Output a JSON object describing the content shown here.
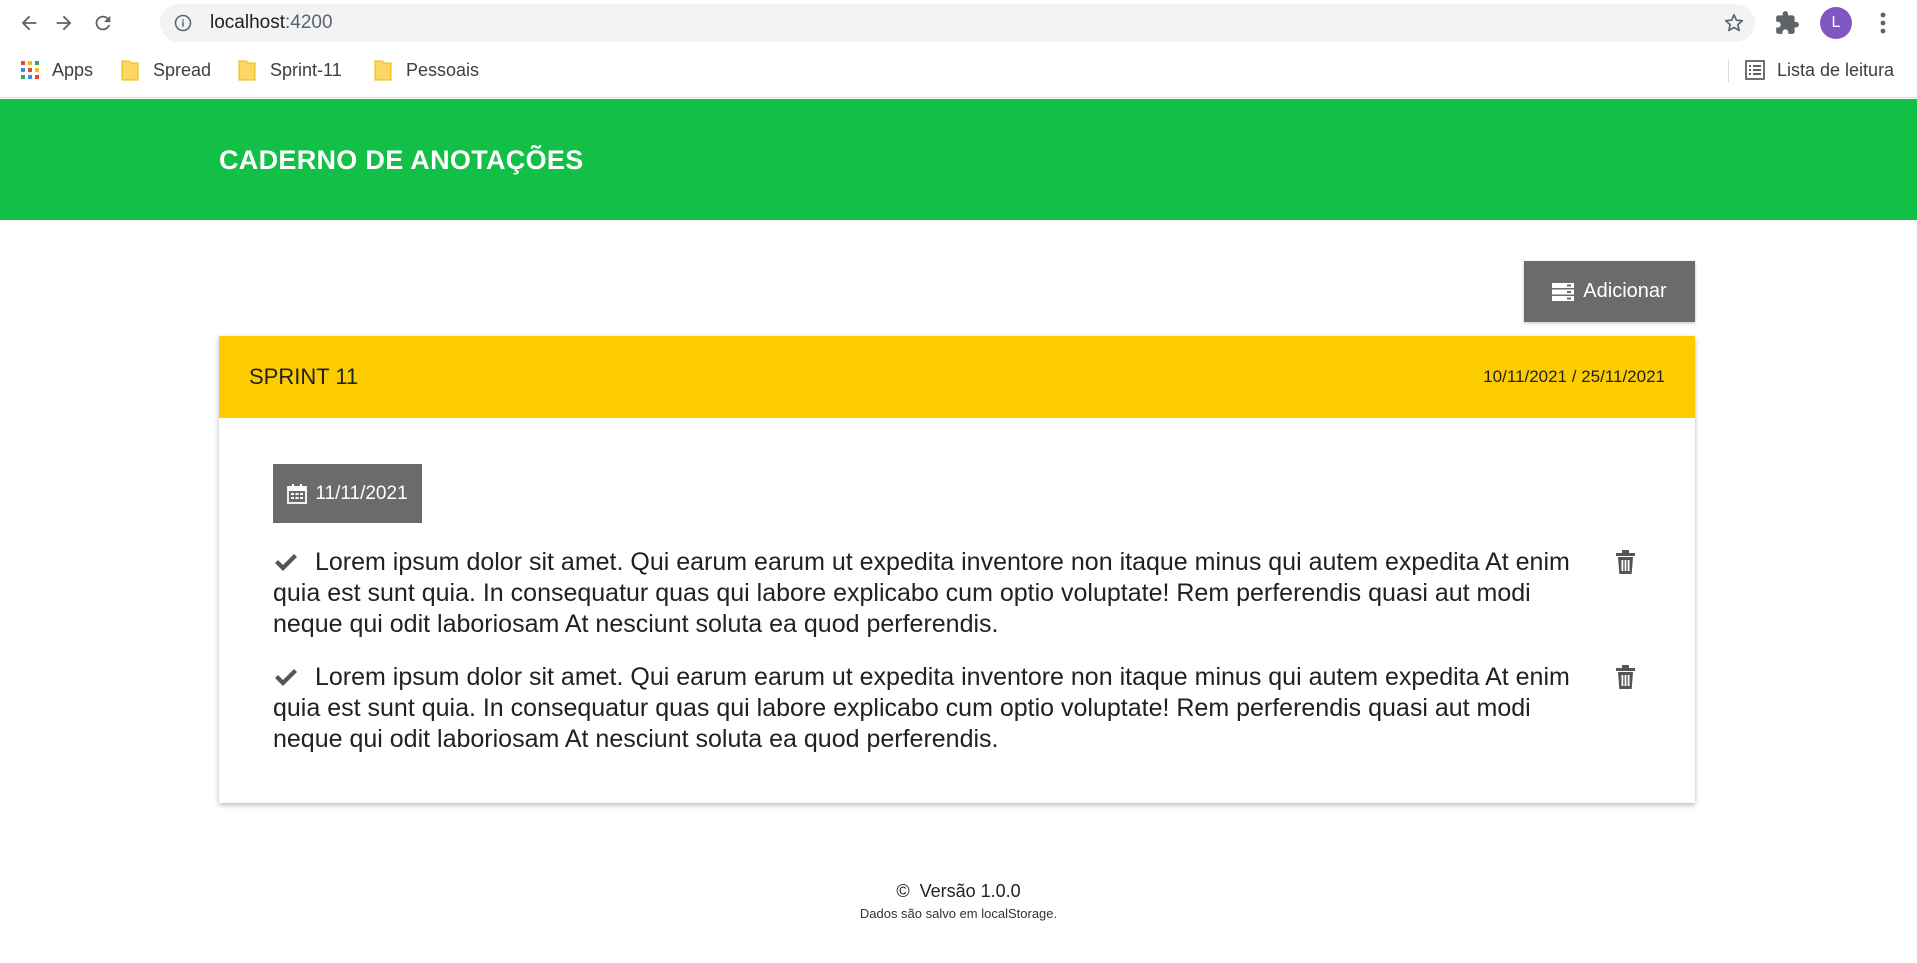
{
  "browser": {
    "url_host": "localhost",
    "url_port": ":4200",
    "profile_initial": "L",
    "bookmarks": [
      {
        "label": "Apps",
        "icon": "apps-grid-icon"
      },
      {
        "label": "Spread",
        "icon": "folder-icon"
      },
      {
        "label": "Sprint-11",
        "icon": "folder-icon"
      },
      {
        "label": "Pessoais",
        "icon": "folder-icon"
      }
    ],
    "reading_list_label": "Lista de leitura"
  },
  "app": {
    "title": "CADERNO DE ANOTAÇÕES",
    "add_button_label": "Adicionar",
    "card": {
      "title": "SPRINT 11",
      "dates": "10/11/2021 / 25/11/2021",
      "day": "11/11/2021",
      "notes": [
        {
          "text": "Lorem ipsum dolor sit amet. Qui earum earum ut expedita inventore non itaque minus qui autem expedita At enim quia est sunt quia. In consequatur quas qui labore explicabo cum optio voluptate! Rem perferendis quasi aut modi neque qui odit laboriosam At nesciunt soluta ea quod perferendis."
        },
        {
          "text": "Lorem ipsum dolor sit amet. Qui earum earum ut expedita inventore non itaque minus qui autem expedita At enim quia est sunt quia. In consequatur quas qui labore explicabo cum optio voluptate! Rem perferendis quasi aut modi neque qui odit laboriosam At nesciunt soluta ea quod perferendis."
        }
      ]
    },
    "footer": {
      "copyright_symbol": "©",
      "version": "Versão 1.0.0",
      "storage_note": "Dados são salvo em localStorage."
    }
  },
  "colors": {
    "header_green": "#12bf47",
    "card_yellow": "#fccc00",
    "button_gray": "#6b6b6b",
    "profile_purple": "#7e57c2"
  }
}
